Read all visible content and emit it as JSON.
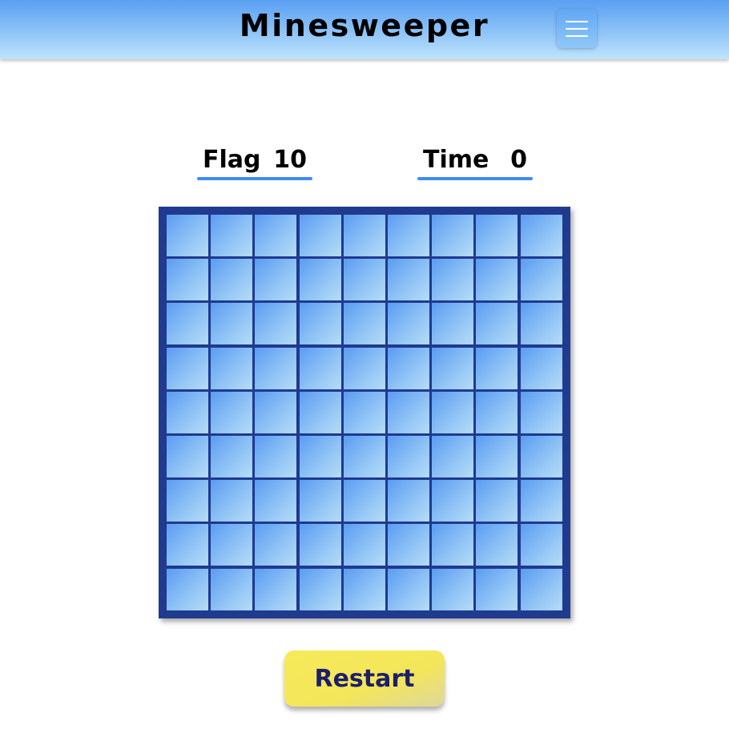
{
  "header": {
    "title": "Minesweeper",
    "menu_icon": "hamburger-menu-icon"
  },
  "stats": {
    "flag_label": "Flag",
    "flag_value": "10",
    "time_label": "Time",
    "time_value": "0"
  },
  "board": {
    "rows": 9,
    "cols": 9,
    "cell_state": "unrevealed"
  },
  "restart_label": "Restart",
  "colors": {
    "header_top": "#5a9ff2",
    "header_bottom": "#bfe4fb",
    "board_border": "#1f3a8f",
    "cell_light": "#b6dcf7",
    "cell_dark": "#5b9cf2",
    "stat_underline": "#3d8cf4",
    "restart_bg": "#f6ea5a",
    "restart_text": "#1d1e6b"
  }
}
